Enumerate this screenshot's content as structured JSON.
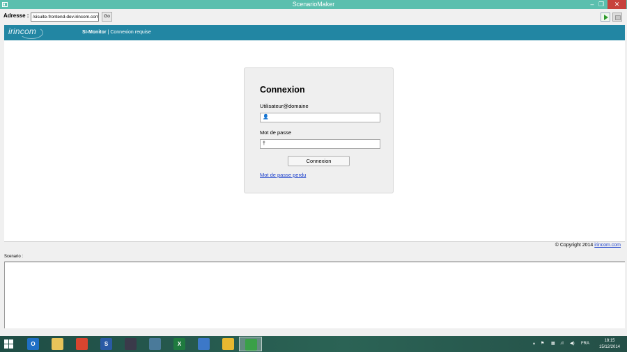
{
  "window": {
    "title": "ScenarioMaker",
    "minimize": "–",
    "maximize": "❐",
    "close": "✕"
  },
  "toolbar": {
    "address_label": "Adresse :",
    "address_value": "/sisuite-frontend-dev.irincom.com",
    "go_label": "Go"
  },
  "site": {
    "logo": "irincom",
    "app_name": "SI-Monitor",
    "separator": "|",
    "page_status": "Connexion requise"
  },
  "login": {
    "heading": "Connexion",
    "user_label": "Utilisateur@domaine",
    "user_value": "",
    "password_label": "Mot de passe",
    "password_value": "",
    "submit_label": "Connexion",
    "lost_password_link": "Mot de passe perdu"
  },
  "footer": {
    "copyright_text": "© Copyright 2014 ",
    "copyright_link": "irincom.com"
  },
  "scenario": {
    "label": "Scenario :",
    "content": ""
  },
  "taskbar": {
    "apps": [
      {
        "icon": "outlook-icon",
        "glyph": "O",
        "color": "#1f6fc5"
      },
      {
        "icon": "file-explorer-icon",
        "glyph": "",
        "color": "#e8c45a"
      },
      {
        "icon": "chrome-icon",
        "glyph": "",
        "color": "#d8452f"
      },
      {
        "icon": "visual-studio-icon",
        "glyph": "S",
        "color": "#2a5aa5"
      },
      {
        "icon": "remote-desktop-icon",
        "glyph": "",
        "color": "#3a3a4a"
      },
      {
        "icon": "network-tool-icon",
        "glyph": "",
        "color": "#4a7a9a"
      },
      {
        "icon": "excel-icon",
        "glyph": "X",
        "color": "#1f7a3f"
      },
      {
        "icon": "virtualbox-icon",
        "glyph": "",
        "color": "#3c78c8"
      },
      {
        "icon": "paint-icon",
        "glyph": "",
        "color": "#e8b830"
      },
      {
        "icon": "scenariomaker-icon",
        "glyph": "",
        "color": "#3aa048"
      }
    ],
    "tray_language": "FRA",
    "clock_time": "18:15",
    "clock_date": "15/12/2014"
  }
}
